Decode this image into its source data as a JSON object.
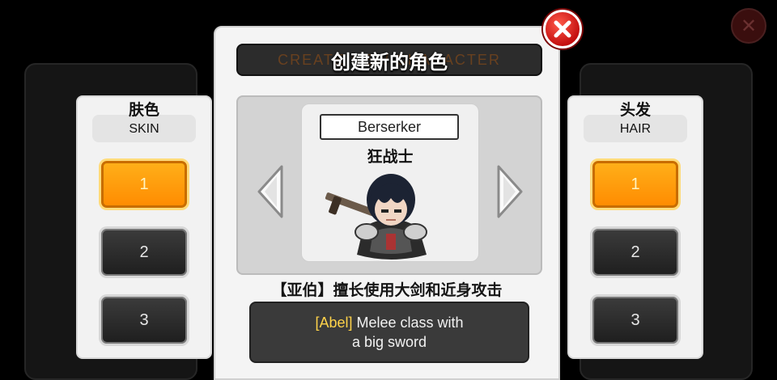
{
  "colors": {
    "accent_orange": "#ff9a00",
    "close_red": "#d0161a",
    "panel_light": "#f2f2f2",
    "panel_dark": "#2c2c2c",
    "highlight_yellow": "#ffd34a"
  },
  "modal": {
    "title": "创建新的角色",
    "title_ghost": "CREATE NEW CHARACTER",
    "close_icon": "close-icon"
  },
  "skin_panel": {
    "label_zh": "肤色",
    "label_en": "SKIN",
    "options": [
      "1",
      "2",
      "3"
    ],
    "selected": "1"
  },
  "hair_panel": {
    "label_zh": "头发",
    "label_en": "HAIR",
    "options": [
      "1",
      "2",
      "3"
    ],
    "selected": "1"
  },
  "character": {
    "class_en": "Berserker",
    "class_zh": "狂战士",
    "prev_icon": "arrow-left-icon",
    "next_icon": "arrow-right-icon"
  },
  "description": {
    "zh": "【亚伯】擅长使用大剑和近身攻击",
    "tag": "[Abel]",
    "line1_rest": " Melee class with",
    "line2": "a big sword"
  }
}
